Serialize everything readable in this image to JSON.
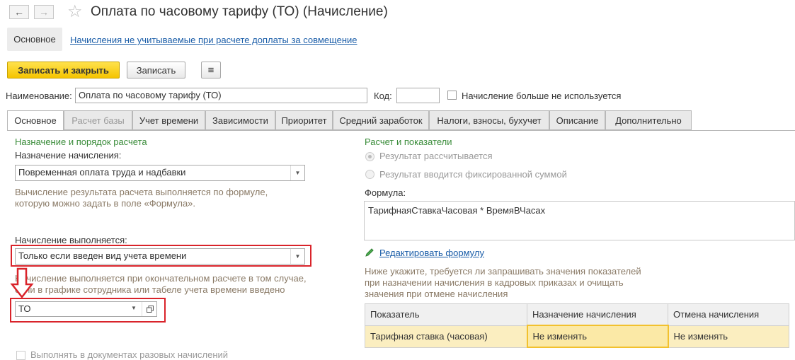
{
  "window": {
    "title": "Оплата по часовому тарифу (ТО) (Начисление)",
    "back_icon": "←",
    "forward_icon": "→",
    "star_icon": "☆"
  },
  "top_nav": {
    "main_tab": "Основное",
    "link": "Начисления не учитываемые при расчете доплаты за совмещение"
  },
  "toolbar": {
    "save_close": "Записать и закрыть",
    "save": "Записать",
    "doc_icon": "≡"
  },
  "header": {
    "name_label": "Наименование:",
    "name_value": "Оплата по часовому тарифу (ТО)",
    "code_label": "Код:",
    "code_value": "",
    "unused_label": "Начисление больше не используется"
  },
  "tabs": [
    {
      "label": "Основное"
    },
    {
      "label": "Расчет базы"
    },
    {
      "label": "Учет времени"
    },
    {
      "label": "Зависимости"
    },
    {
      "label": "Приоритет"
    },
    {
      "label": "Средний заработок"
    },
    {
      "label": "Налоги, взносы, бухучет"
    },
    {
      "label": "Описание"
    },
    {
      "label": "Дополнительно"
    }
  ],
  "left": {
    "section_title": "Назначение и порядок расчета",
    "purpose_label": "Назначение начисления:",
    "purpose_value": "Повременная оплата труда и надбавки",
    "formula_hint_1": "Вычисление результата расчета выполняется по формуле,",
    "formula_hint_2": "которую можно задать в поле «Формула».",
    "performed_label": "Начисление выполняется:",
    "performed_value": "Только если введен вид учета времени",
    "performed_hint_1": "Начисление выполняется при окончательном расчете в том случае,",
    "performed_hint_2": "если в графике сотрудника или табеле учета времени введено",
    "time_kind_value": "ТО",
    "cut_off_text": "Выполнять в документах разовых начислений"
  },
  "right": {
    "section_title": "Расчет и показатели",
    "radio_calculated": "Результат рассчитывается",
    "radio_fixed": "Результат вводится фиксированной суммой",
    "formula_label": "Формула:",
    "formula_value": "ТарифнаяСтавкаЧасовая * ВремяВЧасах",
    "edit_formula_link": "Редактировать формулу",
    "indicators_hint_1": "Ниже укажите, требуется ли запрашивать значения показателей",
    "indicators_hint_2": "при назначении начисления в кадровых приказах и очищать",
    "indicators_hint_3": "значения при отмене начисления"
  },
  "indicators_table": {
    "columns": [
      "Показатель",
      "Назначение начисления",
      "Отмена начисления"
    ],
    "rows": [
      [
        "Тарифная ставка (часовая)",
        "Не изменять",
        "Не изменять"
      ]
    ]
  },
  "colors": {
    "accent_red": "#d9232a",
    "section_green": "#3a8c3a",
    "primary_yellow": "#f5c400"
  }
}
